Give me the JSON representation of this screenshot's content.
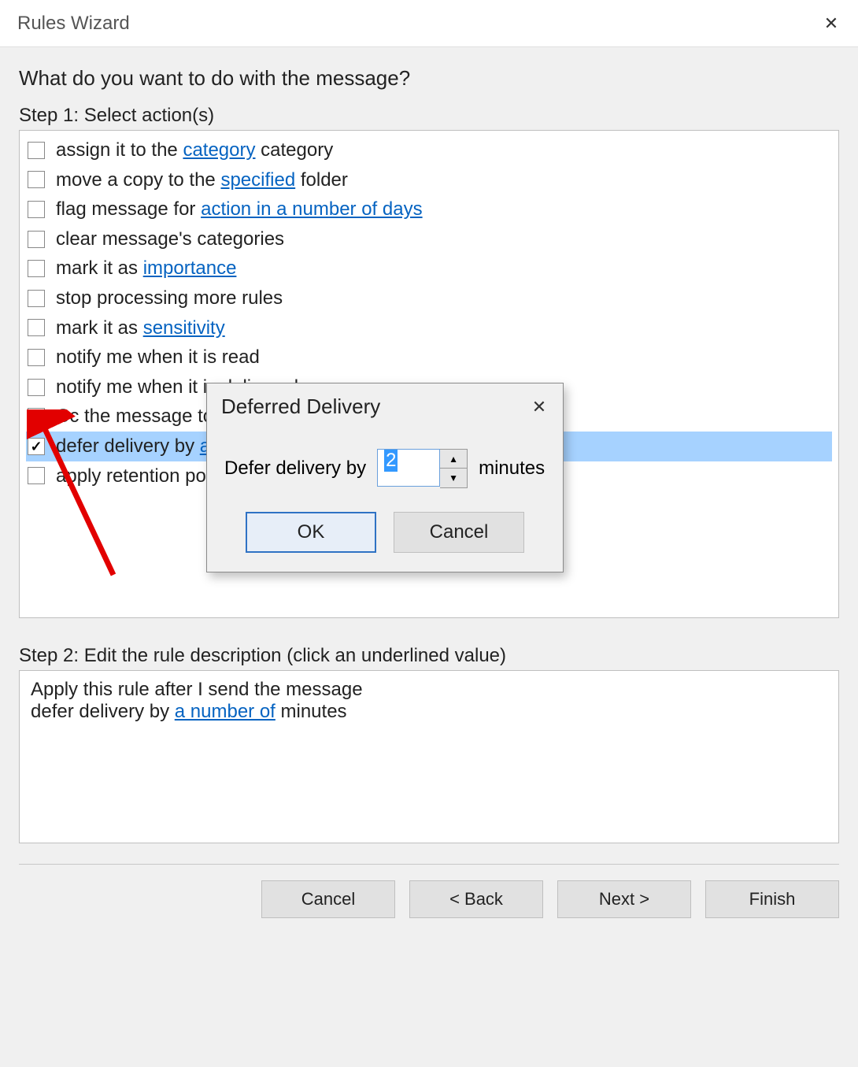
{
  "title": "Rules Wizard",
  "heading": "What do you want to do with the message?",
  "step1_label": "Step 1: Select action(s)",
  "actions": [
    {
      "checked": false,
      "selected": false,
      "parts": [
        {
          "t": "assign it to the "
        },
        {
          "t": "category",
          "link": true
        },
        {
          "t": " category"
        }
      ]
    },
    {
      "checked": false,
      "selected": false,
      "parts": [
        {
          "t": "move a copy to the "
        },
        {
          "t": "specified",
          "link": true
        },
        {
          "t": " folder"
        }
      ]
    },
    {
      "checked": false,
      "selected": false,
      "parts": [
        {
          "t": "flag message for "
        },
        {
          "t": "action in a number of days",
          "link": true
        }
      ]
    },
    {
      "checked": false,
      "selected": false,
      "parts": [
        {
          "t": "clear message's categories"
        }
      ]
    },
    {
      "checked": false,
      "selected": false,
      "parts": [
        {
          "t": "mark it as "
        },
        {
          "t": "importance",
          "link": true
        }
      ]
    },
    {
      "checked": false,
      "selected": false,
      "parts": [
        {
          "t": "stop processing more rules"
        }
      ]
    },
    {
      "checked": false,
      "selected": false,
      "parts": [
        {
          "t": "mark it as "
        },
        {
          "t": "sensitivity",
          "link": true
        }
      ]
    },
    {
      "checked": false,
      "selected": false,
      "parts": [
        {
          "t": "notify me when it is read"
        }
      ]
    },
    {
      "checked": false,
      "selected": false,
      "parts": [
        {
          "t": "notify me when it is delivered"
        }
      ]
    },
    {
      "checked": false,
      "selected": false,
      "parts": [
        {
          "t": "Cc the message to "
        }
      ]
    },
    {
      "checked": true,
      "selected": true,
      "parts": [
        {
          "t": "defer delivery by "
        },
        {
          "t": "a",
          "link": true
        }
      ]
    },
    {
      "checked": false,
      "selected": false,
      "parts": [
        {
          "t": "apply retention po"
        }
      ]
    }
  ],
  "step2_label": "Step 2: Edit the rule description (click an underlined value)",
  "rule_desc_line1": "Apply this rule after I send the message",
  "rule_desc_defer_pre": "defer delivery by ",
  "rule_desc_defer_link": "a number of",
  "rule_desc_defer_post": " minutes",
  "buttons": {
    "cancel": "Cancel",
    "back": "< Back",
    "next": "Next >",
    "finish": "Finish"
  },
  "popup": {
    "title": "Deferred Delivery",
    "label": "Defer delivery by",
    "value": "2",
    "unit": "minutes",
    "ok": "OK",
    "cancel": "Cancel"
  }
}
